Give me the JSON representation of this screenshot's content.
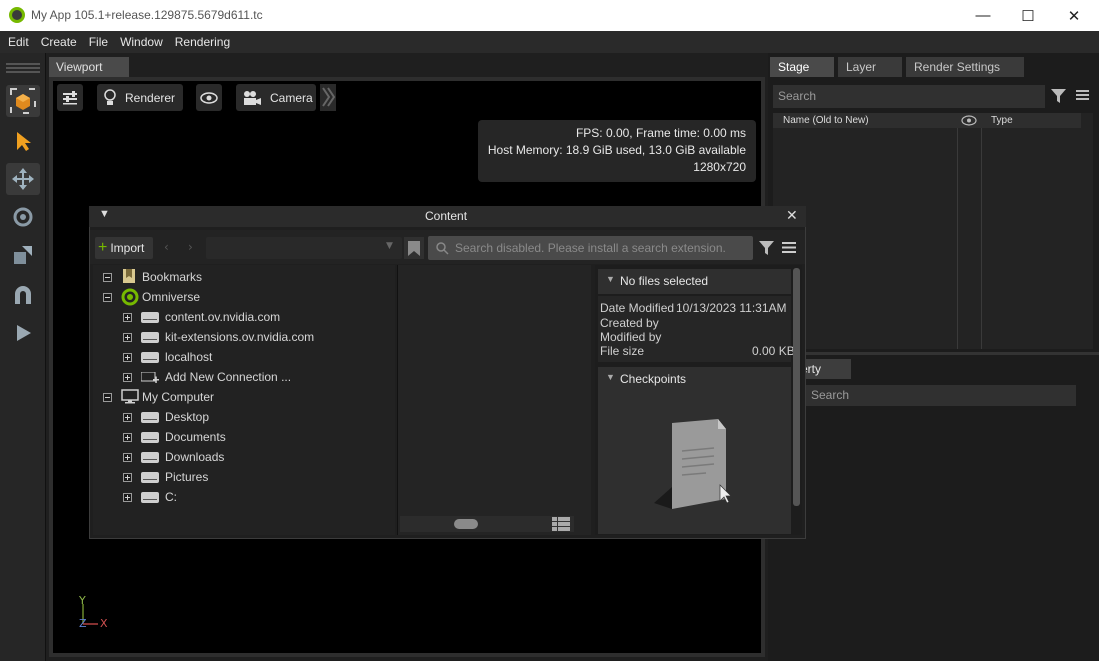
{
  "window": {
    "title": "My App 105.1+release.129875.5679d611.tc",
    "minimize": "—",
    "maximize": "☐",
    "close": "✕"
  },
  "menu": [
    "Edit",
    "Create",
    "File",
    "Window",
    "Rendering"
  ],
  "viewport": {
    "tab": "Viewport",
    "renderer_label": "Renderer",
    "camera_label": "Camera",
    "stats": {
      "line1": "FPS: 0.00, Frame time: 0.00 ms",
      "line2": "Host Memory: 18.9 GiB used, 13.0 GiB available",
      "line3": "1280x720"
    },
    "axis": {
      "y": "Y",
      "z": "Z",
      "x": "X"
    }
  },
  "stage": {
    "tabs": [
      "Stage",
      "Layer",
      "Render Settings"
    ],
    "search_placeholder": "Search",
    "columns": [
      "Name (Old to New)",
      "Type"
    ]
  },
  "property": {
    "tab": "erty",
    "search_placeholder": "Search"
  },
  "content": {
    "title": "Content",
    "import_label": "Import",
    "search_placeholder": "Search disabled. Please install a search extension.",
    "tree": {
      "bookmarks": "Bookmarks",
      "omniverse": "Omniverse",
      "servers": [
        "content.ov.nvidia.com",
        "kit-extensions.ov.nvidia.com",
        "localhost",
        "Add New Connection ..."
      ],
      "my_computer": "My Computer",
      "folders": [
        "Desktop",
        "Documents",
        "Downloads",
        "Pictures",
        "C:"
      ]
    },
    "details": {
      "no_files": "No files selected",
      "date_modified_label": "Date Modified",
      "date_modified_value": "10/13/2023 11:31AM",
      "created_by_label": "Created by",
      "modified_by_label": "Modified by",
      "file_size_label": "File size",
      "file_size_value": "0.00 KB",
      "checkpoints": "Checkpoints"
    }
  }
}
